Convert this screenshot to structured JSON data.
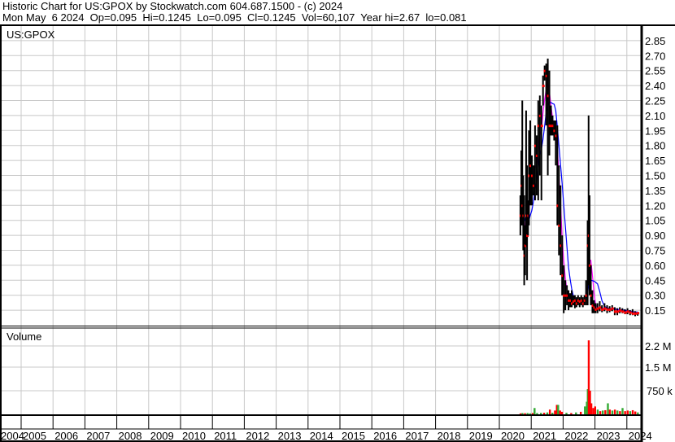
{
  "header": {
    "line1": "Historic Chart for US:GPOX by Stockwatch.com 604.687.1500 - (c) 2024",
    "line2": "Mon May  6 2024  Op=0.095  Hi=0.1245  Lo=0.095  Cl=0.1245  Vol=60,107  Year hi=2.67  lo=0.081"
  },
  "chart_data": {
    "type": "line",
    "title": "Historic Chart for US:GPOX",
    "symbol_label": "US:GPOX",
    "volume_label": "Volume",
    "colors": {
      "price": "#000000",
      "close_marker": "#ff0000",
      "ma_short": "#ff00ff",
      "ma_long": "#0000ff",
      "vol_up": "#33aa33",
      "vol_down": "#ff0000",
      "grid": "#c8c8c8"
    },
    "x_ticks": [
      "2004",
      "2005",
      "2006",
      "2007",
      "2008",
      "2009",
      "2010",
      "2011",
      "2012",
      "2013",
      "2014",
      "2015",
      "2016",
      "2017",
      "2018",
      "2019",
      "2020",
      "2021",
      "2022",
      "2023",
      "2024"
    ],
    "y_ticks": [
      "2.85",
      "2.70",
      "2.55",
      "2.40",
      "2.25",
      "2.10",
      "1.95",
      "1.80",
      "1.65",
      "1.50",
      "1.35",
      "1.20",
      "1.05",
      "0.90",
      "0.75",
      "0.60",
      "0.45",
      "0.30",
      "0.15"
    ],
    "ylim": [
      0,
      2.95
    ],
    "volume_ticks": [
      {
        "label": "2.2 M",
        "value": 2250000
      },
      {
        "label": "1.5 M",
        "value": 1500000
      },
      {
        "label": "750 k",
        "value": 750000
      }
    ],
    "price_bars_columns": [
      "date",
      "high",
      "low",
      "close"
    ],
    "price_bars": [
      [
        2020.66,
        1.3,
        0.9,
        1.1
      ],
      [
        2020.69,
        1.75,
        1.0,
        1.4
      ],
      [
        2020.72,
        2.25,
        1.0,
        1.2
      ],
      [
        2020.75,
        1.5,
        0.75,
        1.1
      ],
      [
        2020.78,
        1.3,
        0.4,
        0.7
      ],
      [
        2020.81,
        1.0,
        0.5,
        0.8
      ],
      [
        2020.84,
        2.15,
        0.8,
        1.1
      ],
      [
        2020.87,
        1.6,
        0.45,
        0.9
      ],
      [
        2020.9,
        1.25,
        0.9,
        1.1
      ],
      [
        2020.93,
        1.95,
        1.0,
        1.5
      ],
      [
        2020.97,
        2.05,
        1.2,
        1.6
      ],
      [
        2021.02,
        1.7,
        1.2,
        1.5
      ],
      [
        2021.07,
        1.6,
        1.3,
        1.4
      ],
      [
        2021.12,
        2.0,
        1.25,
        1.8
      ],
      [
        2021.17,
        1.9,
        1.3,
        1.7
      ],
      [
        2021.22,
        2.25,
        1.25,
        2.0
      ],
      [
        2021.27,
        2.3,
        1.5,
        2.1
      ],
      [
        2021.32,
        2.2,
        1.25,
        2.0
      ],
      [
        2021.37,
        2.5,
        2.2,
        2.4
      ],
      [
        2021.42,
        2.6,
        2.45,
        2.55
      ],
      [
        2021.47,
        2.62,
        2.0,
        2.5
      ],
      [
        2021.52,
        2.67,
        1.5,
        2.3
      ],
      [
        2021.57,
        2.55,
        1.7,
        2.0
      ],
      [
        2021.62,
        2.2,
        1.9,
        2.0
      ],
      [
        2021.67,
        2.1,
        1.9,
        2.0
      ],
      [
        2021.72,
        2.05,
        1.85,
        1.95
      ],
      [
        2021.77,
        2.05,
        1.6,
        1.9
      ],
      [
        2021.82,
        2.0,
        1.0,
        1.2
      ],
      [
        2021.87,
        1.6,
        0.7,
        1.0
      ],
      [
        2021.92,
        1.4,
        0.5,
        0.8
      ],
      [
        2021.97,
        0.9,
        0.3,
        0.5
      ],
      [
        2022.02,
        0.6,
        0.12,
        0.3
      ],
      [
        2022.07,
        0.45,
        0.15,
        0.3
      ],
      [
        2022.12,
        0.4,
        0.2,
        0.3
      ],
      [
        2022.17,
        0.35,
        0.15,
        0.25
      ],
      [
        2022.22,
        0.32,
        0.18,
        0.25
      ],
      [
        2022.27,
        0.35,
        0.18,
        0.22
      ],
      [
        2022.32,
        0.3,
        0.2,
        0.24
      ],
      [
        2022.37,
        0.3,
        0.17,
        0.25
      ],
      [
        2022.42,
        0.28,
        0.18,
        0.22
      ],
      [
        2022.47,
        0.3,
        0.2,
        0.25
      ],
      [
        2022.52,
        0.28,
        0.18,
        0.24
      ],
      [
        2022.57,
        0.3,
        0.2,
        0.25
      ],
      [
        2022.62,
        0.28,
        0.18,
        0.22
      ],
      [
        2022.67,
        0.3,
        0.2,
        0.25
      ],
      [
        2022.72,
        0.45,
        0.2,
        0.3
      ],
      [
        2022.77,
        1.05,
        0.2,
        0.8
      ],
      [
        2022.8,
        2.1,
        0.4,
        0.9
      ],
      [
        2022.83,
        1.3,
        0.3,
        0.6
      ],
      [
        2022.87,
        0.6,
        0.2,
        0.3
      ],
      [
        2022.92,
        0.35,
        0.12,
        0.2
      ],
      [
        2022.97,
        0.25,
        0.12,
        0.18
      ],
      [
        2023.02,
        0.22,
        0.12,
        0.16
      ],
      [
        2023.08,
        0.22,
        0.12,
        0.17
      ],
      [
        2023.15,
        0.24,
        0.14,
        0.18
      ],
      [
        2023.22,
        0.2,
        0.13,
        0.16
      ],
      [
        2023.3,
        0.22,
        0.14,
        0.17
      ],
      [
        2023.38,
        0.2,
        0.12,
        0.16
      ],
      [
        2023.46,
        0.19,
        0.13,
        0.16
      ],
      [
        2023.54,
        0.2,
        0.14,
        0.17
      ],
      [
        2023.62,
        0.18,
        0.1,
        0.14
      ],
      [
        2023.7,
        0.17,
        0.1,
        0.14
      ],
      [
        2023.78,
        0.18,
        0.12,
        0.15
      ],
      [
        2023.86,
        0.17,
        0.12,
        0.14
      ],
      [
        2023.94,
        0.16,
        0.11,
        0.13
      ],
      [
        2024.02,
        0.17,
        0.11,
        0.14
      ],
      [
        2024.1,
        0.15,
        0.1,
        0.13
      ],
      [
        2024.18,
        0.16,
        0.1,
        0.12
      ],
      [
        2024.26,
        0.14,
        0.09,
        0.12
      ],
      [
        2024.34,
        0.13,
        0.095,
        0.1245
      ]
    ],
    "volume_columns": [
      "date",
      "volume",
      "direction"
    ],
    "volume": [
      [
        2020.66,
        30000,
        "down"
      ],
      [
        2020.72,
        40000,
        "up"
      ],
      [
        2020.8,
        35000,
        "down"
      ],
      [
        2020.88,
        40000,
        "up"
      ],
      [
        2020.96,
        30000,
        "up"
      ],
      [
        2021.04,
        40000,
        "down"
      ],
      [
        2021.1,
        200000,
        "up"
      ],
      [
        2021.18,
        40000,
        "up"
      ],
      [
        2021.3,
        45000,
        "up"
      ],
      [
        2021.4,
        50000,
        "down"
      ],
      [
        2021.5,
        60000,
        "up"
      ],
      [
        2021.58,
        150000,
        "down"
      ],
      [
        2021.66,
        50000,
        "up"
      ],
      [
        2021.74,
        120000,
        "down"
      ],
      [
        2021.8,
        300000,
        "down"
      ],
      [
        2021.84,
        300000,
        "up"
      ],
      [
        2021.9,
        120000,
        "down"
      ],
      [
        2021.96,
        80000,
        "down"
      ],
      [
        2022.1,
        50000,
        "up"
      ],
      [
        2022.25,
        40000,
        "down"
      ],
      [
        2022.4,
        60000,
        "up"
      ],
      [
        2022.55,
        80000,
        "down"
      ],
      [
        2022.68,
        250000,
        "up"
      ],
      [
        2022.74,
        400000,
        "up"
      ],
      [
        2022.77,
        800000,
        "up"
      ],
      [
        2022.8,
        2350000,
        "down"
      ],
      [
        2022.84,
        750000,
        "down"
      ],
      [
        2022.88,
        350000,
        "down"
      ],
      [
        2022.94,
        200000,
        "down"
      ],
      [
        2023.0,
        250000,
        "down"
      ],
      [
        2023.08,
        150000,
        "up"
      ],
      [
        2023.16,
        100000,
        "down"
      ],
      [
        2023.24,
        120000,
        "up"
      ],
      [
        2023.32,
        130000,
        "down"
      ],
      [
        2023.4,
        350000,
        "up"
      ],
      [
        2023.46,
        150000,
        "down"
      ],
      [
        2023.54,
        120000,
        "up"
      ],
      [
        2023.62,
        150000,
        "down"
      ],
      [
        2023.7,
        120000,
        "up"
      ],
      [
        2023.78,
        100000,
        "down"
      ],
      [
        2023.86,
        200000,
        "up"
      ],
      [
        2023.94,
        100000,
        "down"
      ],
      [
        2024.02,
        120000,
        "down"
      ],
      [
        2024.1,
        100000,
        "up"
      ],
      [
        2024.18,
        130000,
        "down"
      ],
      [
        2024.26,
        90000,
        "down"
      ],
      [
        2024.34,
        60107,
        "up"
      ]
    ]
  }
}
